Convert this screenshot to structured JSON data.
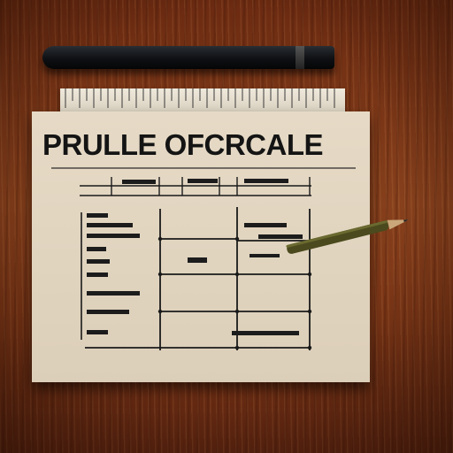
{
  "title": "PRULLE OFCRCALE",
  "colors": {
    "wood": "#7a3516",
    "paper": "#e0d4bf",
    "ink": "#141414",
    "marker": "#0e1013",
    "pencil": "#4b4a1e"
  },
  "icons": [
    "marker-pen",
    "ruler",
    "pencil"
  ]
}
